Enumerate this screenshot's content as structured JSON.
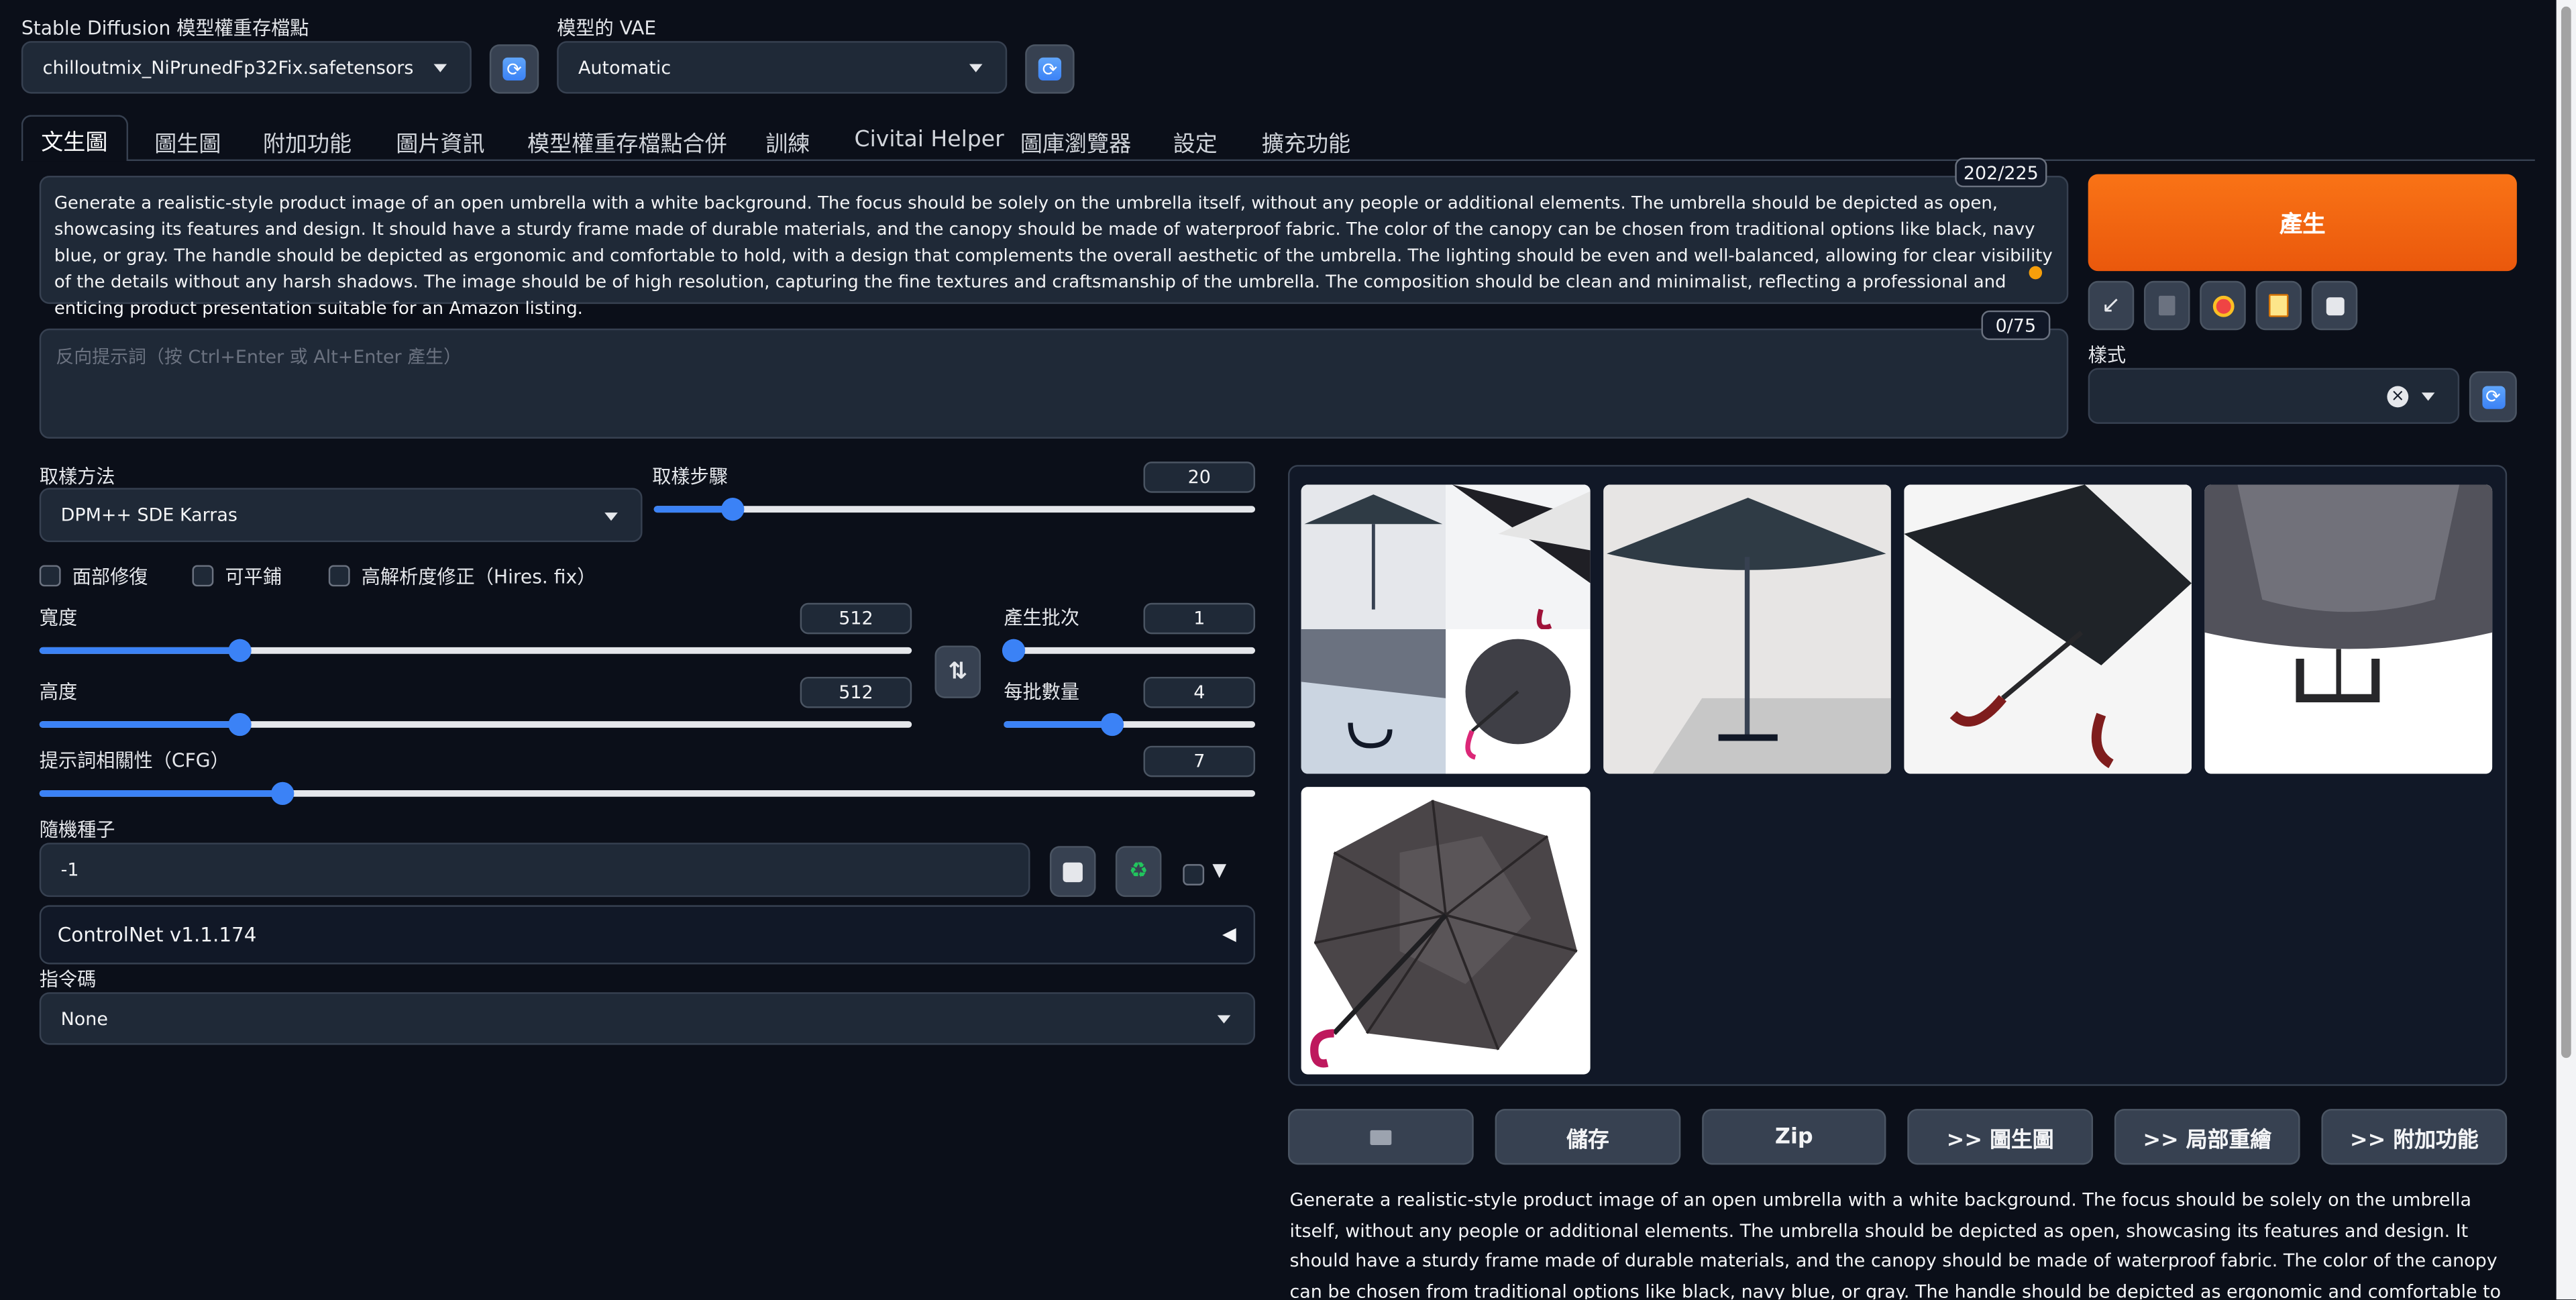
{
  "colors": {
    "accent": "#3b82f6",
    "generate": "#f97316",
    "background": "#0b0f19",
    "panel": "#1f2937"
  },
  "checkpoint": {
    "label": "Stable Diffusion 模型權重存檔點",
    "value": "chilloutmix_NiPrunedFp32Fix.safetensors",
    "refresh_icon": "refresh-icon"
  },
  "vae": {
    "label": "模型的 VAE",
    "value": "Automatic",
    "refresh_icon": "refresh-icon"
  },
  "tabs": [
    "文生圖",
    "圖生圖",
    "附加功能",
    "圖片資訊",
    "模型權重存檔點合併",
    "訓練",
    "Civitai Helper",
    "圖庫瀏覽器",
    "設定",
    "擴充功能"
  ],
  "prompt": {
    "token_count": "202/225",
    "text": "Generate a realistic-style product image of an open umbrella with a white background. The focus should be solely on the umbrella itself, without any people or additional elements. The umbrella should be depicted as open, showcasing its features and design. It should have a sturdy frame made of durable materials, and the canopy should be made of waterproof fabric. The color of the canopy can be chosen from traditional options like black, navy blue, or gray. The handle should be depicted as ergonomic and comfortable to hold, with a design that complements the overall aesthetic of the umbrella. The lighting should be even and well-balanced, allowing for clear visibility of the details without any harsh shadows. The image should be of high resolution, capturing the fine textures and craftsmanship of the umbrella. The composition should be clean and minimalist, reflecting a professional and enticing product presentation suitable for an Amazon listing."
  },
  "negative_prompt": {
    "token_count": "0/75",
    "placeholder": "反向提示詞（按 Ctrl+Enter 或 Alt+Enter 產生）"
  },
  "generate_label": "產生",
  "tool_icons": [
    "arrow-down-left-icon",
    "trash-icon",
    "red-dot-icon",
    "clipboard-icon",
    "save-icon"
  ],
  "styles": {
    "label": "樣式",
    "value": ""
  },
  "sampling": {
    "method_label": "取樣方法",
    "method_value": "DPM++ SDE Karras",
    "steps_label": "取樣步驟",
    "steps_value": "20",
    "steps_fraction": 0.13
  },
  "checkboxes": [
    "面部修復",
    "可平鋪",
    "高解析度修正（Hires. fix）"
  ],
  "width": {
    "label": "寬度",
    "value": "512",
    "fraction": 0.23
  },
  "height": {
    "label": "高度",
    "value": "512",
    "fraction": 0.23
  },
  "swap_icon": "swap-vertical-icon",
  "batch_count": {
    "label": "產生批次",
    "value": "1",
    "fraction": 0.0
  },
  "batch_size": {
    "label": "每批數量",
    "value": "4",
    "fraction": 0.43
  },
  "cfg": {
    "label": "提示詞相關性（CFG）",
    "value": "7",
    "fraction": 0.2
  },
  "seed": {
    "label": "隨機種子",
    "value": "-1",
    "dice_icon": "dice-icon",
    "recycle_icon": "recycle-icon",
    "expand_icon": "triangle-down-icon"
  },
  "controlnet": {
    "label": "ControlNet v1.1.174",
    "toggle_icon": "triangle-left-icon"
  },
  "script": {
    "label": "指令碼",
    "value": "None"
  },
  "gallery": {
    "images": [
      "umbrella-grid-image",
      "umbrella-patio-image",
      "umbrella-angled-image",
      "umbrella-closeup-image",
      "umbrella-underside-image"
    ]
  },
  "actions": {
    "folder_icon": "folder-icon",
    "save": "儲存",
    "zip": "Zip",
    "to_img2img": ">> 圖生圖",
    "to_inpaint": ">> 局部重繪",
    "to_extras": ">> 附加功能"
  },
  "output_info": "Generate a realistic-style product image of an open umbrella with a white background. The focus should be solely on the umbrella itself, without any people or additional elements. The umbrella should be depicted as open, showcasing its features and design. It should have a sturdy frame made of durable materials, and the canopy should be made of waterproof fabric. The color of the canopy can be chosen from traditional options like black, navy blue, or gray. The handle should be depicted as ergonomic and comfortable to hold, with a design that complements the overall aesthetic of the umbrella. The"
}
